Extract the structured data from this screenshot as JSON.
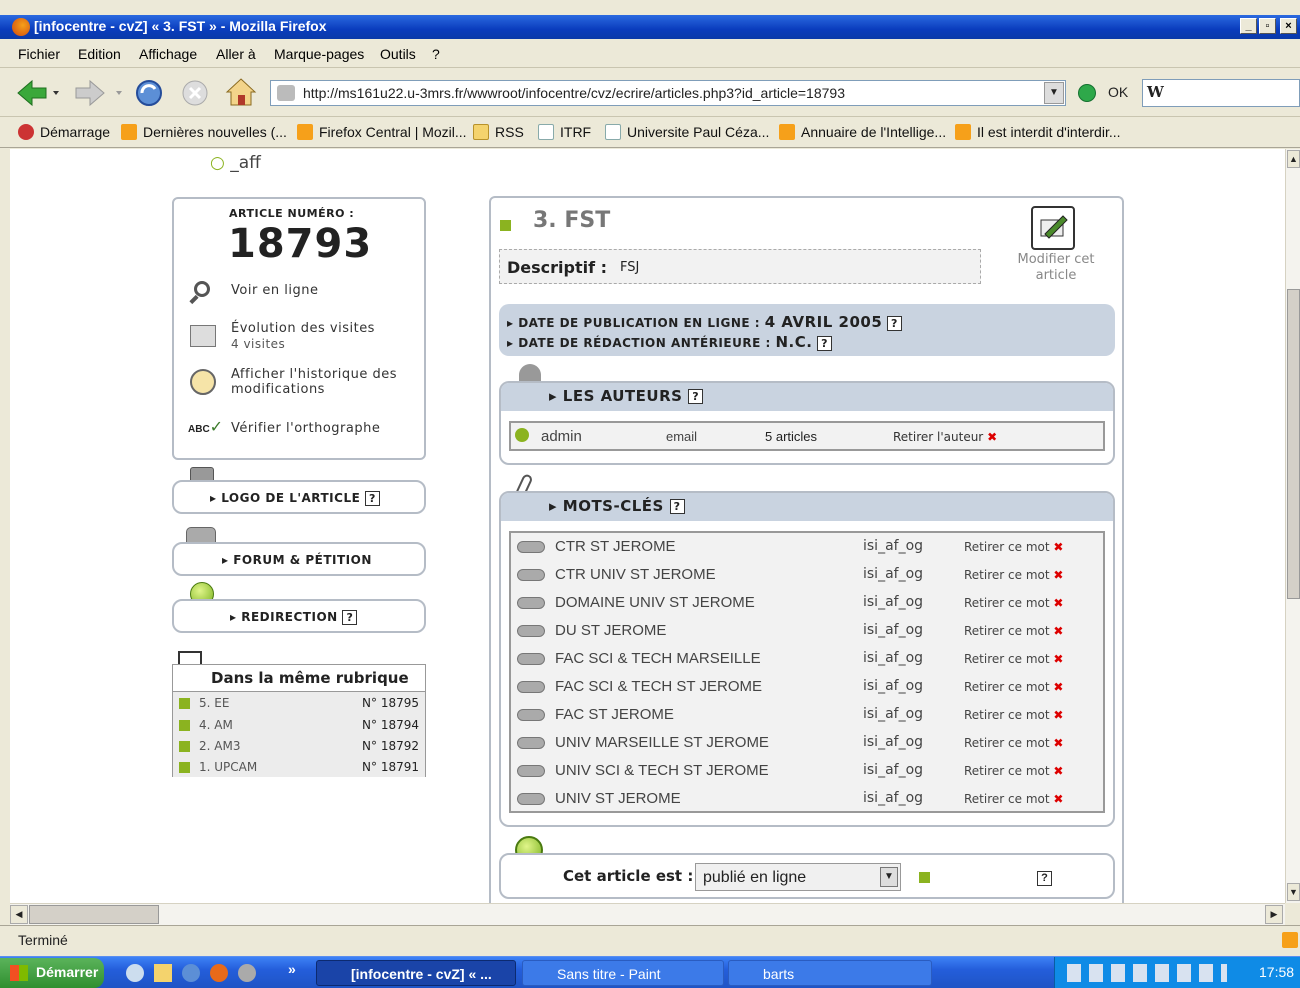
{
  "window": {
    "title": "[infocentre - cvZ] « 3. FST » - Mozilla Firefox"
  },
  "menu": [
    "Fichier",
    "Edition",
    "Affichage",
    "Aller à",
    "Marque-pages",
    "Outils",
    "?"
  ],
  "nav": {
    "url": "http://ms161u22.u-3mrs.fr/wwwroot/infocentre/cvz/ecrire/articles.php3?id_article=18793",
    "ok_label": "OK"
  },
  "bookmarks": [
    {
      "label": "Démarrage",
      "icon": "firefox-icon"
    },
    {
      "label": "Dernières nouvelles (...",
      "icon": "rss-icon"
    },
    {
      "label": "Firefox Central | Mozil...",
      "icon": "rss-icon"
    },
    {
      "label": "RSS",
      "icon": "folder-icon"
    },
    {
      "label": "ITRF",
      "icon": "page-icon"
    },
    {
      "label": "Universite Paul Céza...",
      "icon": "page-icon"
    },
    {
      "label": "Annuaire de l'Intellige...",
      "icon": "rss-icon"
    },
    {
      "label": "Il est interdit d'interdir...",
      "icon": "rss-icon"
    }
  ],
  "top_fragment": "_aff",
  "sidebar": {
    "article_label": "ARTICLE NUMÉRO :",
    "article_number": "18793",
    "actions": [
      {
        "label": "Voir en ligne",
        "sub": "",
        "icon": "magnifier-icon"
      },
      {
        "label": "Évolution des visites",
        "sub": "4 visites",
        "icon": "stats-icon"
      },
      {
        "label": "Afficher l'historique des modifications",
        "sub": "",
        "icon": "history-icon"
      },
      {
        "label": "Vérifier l'orthographe",
        "sub": "",
        "icon": "spellcheck-icon"
      }
    ],
    "logo_label": "LOGO DE L'ARTICLE",
    "forum_label": "FORUM & PÉTITION",
    "redirect_label": "REDIRECTION",
    "rubrique_title": "Dans la même rubrique",
    "rubrique_items": [
      {
        "name": "5. EE",
        "num": "N° 18795"
      },
      {
        "name": "4. AM",
        "num": "N° 18794"
      },
      {
        "name": "2. AM3",
        "num": "N° 18792"
      },
      {
        "name": "1. UPCAM",
        "num": "N° 18791"
      }
    ]
  },
  "main": {
    "title": "3. FST",
    "descriptif_label": "Descriptif :",
    "descriptif_value": "FSJ",
    "modify_label": "Modifier cet article",
    "pub_date_label": "DATE DE PUBLICATION EN LIGNE :",
    "pub_date_value": "4 AVRIL 2005",
    "redac_date_label": "DATE DE RÉDACTION ANTÉRIEURE :",
    "redac_date_value": "N.C.",
    "authors_title": "LES AUTEURS",
    "author": {
      "name": "admin",
      "email": "email",
      "articles": "5 articles",
      "remove": "Retirer l'auteur"
    },
    "keywords_title": "MOTS-CLÉS",
    "keywords": [
      {
        "label": "CTR ST JEROME",
        "group": "isi_af_og"
      },
      {
        "label": "CTR UNIV ST JEROME",
        "group": "isi_af_og"
      },
      {
        "label": "DOMAINE UNIV ST JEROME",
        "group": "isi_af_og"
      },
      {
        "label": "DU ST JEROME",
        "group": "isi_af_og"
      },
      {
        "label": "FAC SCI & TECH MARSEILLE",
        "group": "isi_af_og"
      },
      {
        "label": "FAC SCI & TECH ST JEROME",
        "group": "isi_af_og"
      },
      {
        "label": "FAC ST JEROME",
        "group": "isi_af_og"
      },
      {
        "label": "UNIV MARSEILLE ST JEROME",
        "group": "isi_af_og"
      },
      {
        "label": "UNIV SCI & TECH ST JEROME",
        "group": "isi_af_og"
      },
      {
        "label": "UNIV ST JEROME",
        "group": "isi_af_og"
      }
    ],
    "remove_keyword": "Retirer ce mot",
    "status_label": "Cet article est :",
    "status_value": "publié en ligne"
  },
  "status": {
    "text": "Terminé"
  },
  "taskbar": {
    "start": "Démarrer",
    "tasks": [
      "[infocentre - cvZ] « ...",
      "Sans titre - Paint",
      "barts"
    ],
    "clock": "17:58"
  },
  "colors": {
    "title_blue": "#0a3cbd",
    "accent_green": "#8bb320",
    "panel_blue": "#c9d3e0",
    "remove_red": "#dd0000"
  }
}
